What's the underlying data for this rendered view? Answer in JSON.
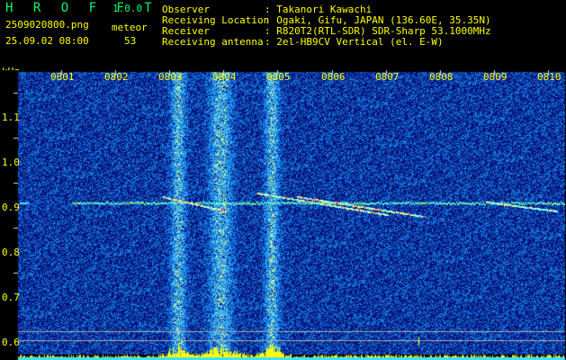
{
  "header": {
    "app_name": "H R O F F T",
    "version": "1.0.0",
    "filename": "250902080­0.png",
    "mode_label": "meteor",
    "datetime": "25.09.02 08:00",
    "count": "53",
    "info_labels": [
      "Observer",
      "Receiving Location",
      "Receiver",
      "Receiving antenna"
    ],
    "info_values": [
      ": Takanori Kawachi",
      ": Ogaki, Gifu, JAPAN (136.60E, 35.35N)",
      ": R820T2(RTL-SDR) SDR-Sharp 53.1000MHz",
      ": 2el-HB9CV Vertical (el. E-W)"
    ]
  },
  "axis": {
    "unit": "kHz",
    "time_labels": [
      "0801",
      "0802",
      "0803",
      "0804",
      "0805",
      "0806",
      "0807",
      "0808",
      "0809",
      "0810"
    ],
    "freq_labels": [
      "1.1",
      "1.0",
      "0.9",
      "0.8",
      "0.7",
      "0.6"
    ],
    "freq_values": [
      1.1,
      1.0,
      0.9,
      0.8,
      0.7,
      0.6
    ]
  },
  "colors": {
    "label_yellow": "#ffff00",
    "label_green": "#00ff66",
    "background_blue": "#0a1a8a",
    "carrier_cyan": "#40e0ff",
    "bottom_bar": "#ffff00"
  }
}
